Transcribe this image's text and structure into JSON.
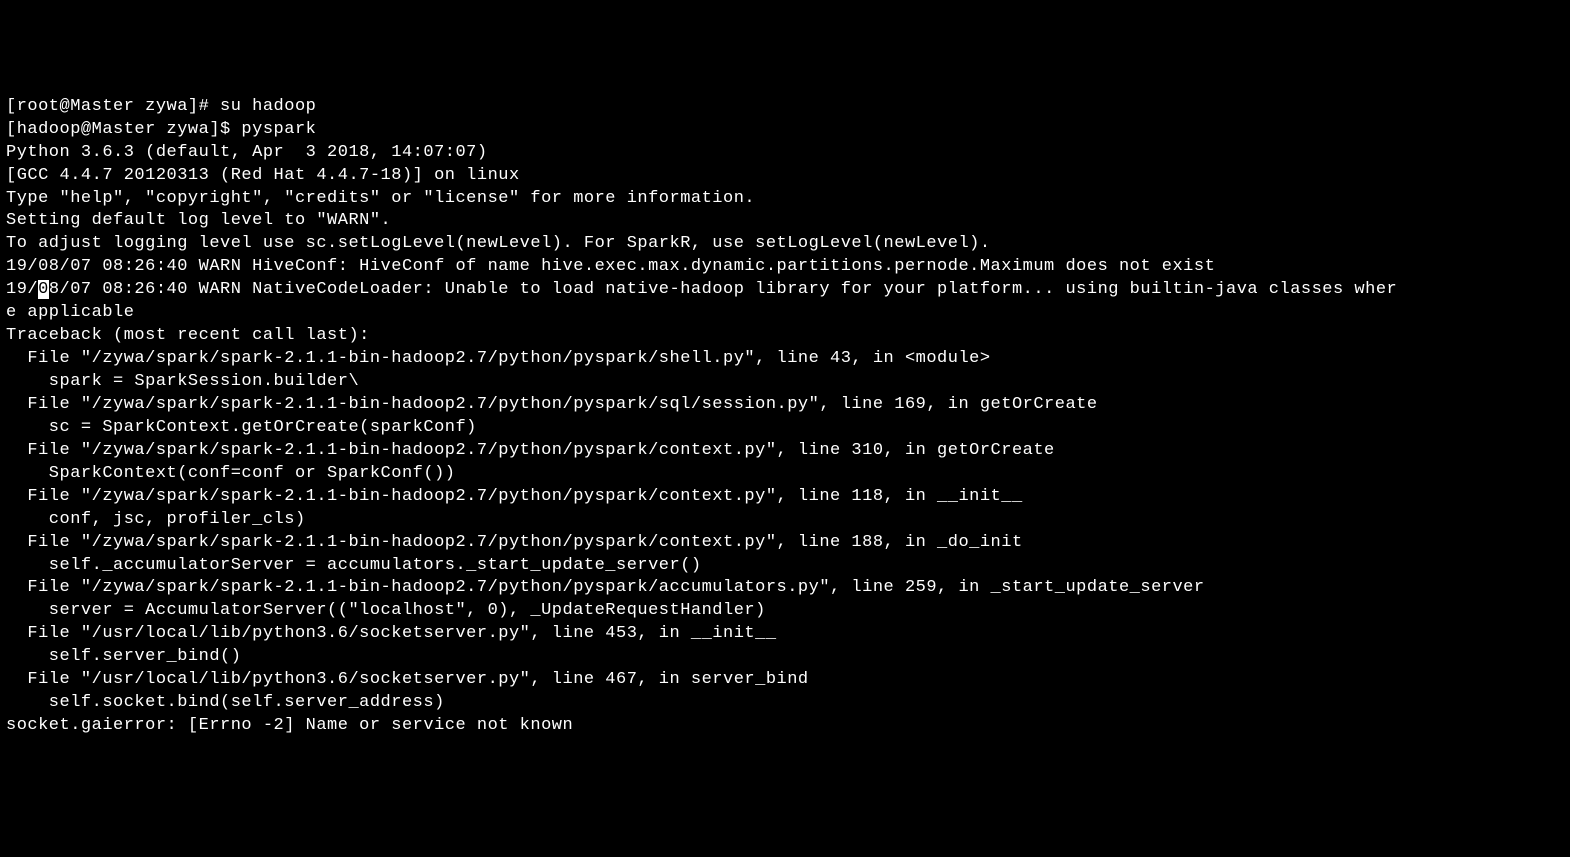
{
  "terminal": {
    "lines": [
      "[root@Master zywa]# su hadoop",
      "[hadoop@Master zywa]$ pyspark",
      "Python 3.6.3 (default, Apr  3 2018, 14:07:07)",
      "[GCC 4.4.7 20120313 (Red Hat 4.4.7-18)] on linux",
      "Type \"help\", \"copyright\", \"credits\" or \"license\" for more information.",
      "Setting default log level to \"WARN\".",
      "To adjust logging level use sc.setLogLevel(newLevel). For SparkR, use setLogLevel(newLevel).",
      "19/08/07 08:26:40 WARN HiveConf: HiveConf of name hive.exec.max.dynamic.partitions.pernode.Maximum does not exist",
      "19/08/07 08:26:40 WARN NativeCodeLoader: Unable to load native-hadoop library for your platform... using builtin-java classes wher",
      "e applicable",
      "Traceback (most recent call last):",
      "  File \"/zywa/spark/spark-2.1.1-bin-hadoop2.7/python/pyspark/shell.py\", line 43, in <module>",
      "    spark = SparkSession.builder\\",
      "  File \"/zywa/spark/spark-2.1.1-bin-hadoop2.7/python/pyspark/sql/session.py\", line 169, in getOrCreate",
      "    sc = SparkContext.getOrCreate(sparkConf)",
      "  File \"/zywa/spark/spark-2.1.1-bin-hadoop2.7/python/pyspark/context.py\", line 310, in getOrCreate",
      "    SparkContext(conf=conf or SparkConf())",
      "  File \"/zywa/spark/spark-2.1.1-bin-hadoop2.7/python/pyspark/context.py\", line 118, in __init__",
      "    conf, jsc, profiler_cls)",
      "  File \"/zywa/spark/spark-2.1.1-bin-hadoop2.7/python/pyspark/context.py\", line 188, in _do_init",
      "    self._accumulatorServer = accumulators._start_update_server()",
      "  File \"/zywa/spark/spark-2.1.1-bin-hadoop2.7/python/pyspark/accumulators.py\", line 259, in _start_update_server",
      "    server = AccumulatorServer((\"localhost\", 0), _UpdateRequestHandler)",
      "  File \"/usr/local/lib/python3.6/socketserver.py\", line 453, in __init__",
      "    self.server_bind()",
      "  File \"/usr/local/lib/python3.6/socketserver.py\", line 467, in server_bind",
      "    self.socket.bind(self.server_address)",
      "socket.gaierror: [Errno -2] Name or service not known"
    ],
    "cursor_line": 8,
    "cursor_before": "19/",
    "cursor_char": "0",
    "cursor_after": "8/07 08:26:40 WARN NativeCodeLoader: Unable to load native-hadoop library for your platform... using builtin-java classes wher"
  }
}
